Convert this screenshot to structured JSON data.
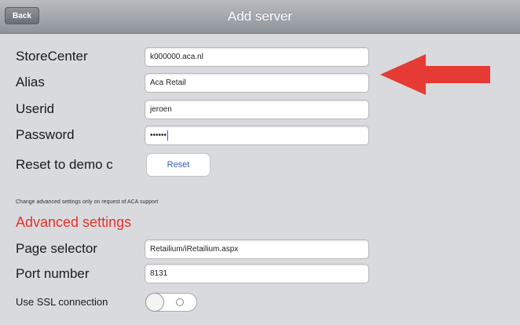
{
  "nav": {
    "back_label": "Back",
    "title": "Add server"
  },
  "form": {
    "storecenter": {
      "label": "StoreCenter",
      "value": "k000000.aca.nl"
    },
    "alias": {
      "label": "Alias",
      "value": "Aca Retail"
    },
    "userid": {
      "label": "Userid",
      "value": "jeroen"
    },
    "password": {
      "label": "Password",
      "value": "••••••"
    },
    "reset": {
      "label": "Reset to demo c",
      "button_label": "Reset"
    }
  },
  "advanced": {
    "note": "Change advanced settings only on request of ACA support",
    "heading": "Advanced settings",
    "page_selector": {
      "label": "Page selector",
      "value": "Retailium/iRetailium.aspx"
    },
    "port_number": {
      "label": "Port number",
      "value": "8131"
    },
    "ssl": {
      "label": "Use SSL connection",
      "state": "off"
    }
  },
  "colors": {
    "accent_red": "#e5322b",
    "arrow_red": "#e63b34",
    "button_text_blue": "#3a5db0"
  },
  "annotation": {
    "icon": "arrow-left-icon"
  }
}
